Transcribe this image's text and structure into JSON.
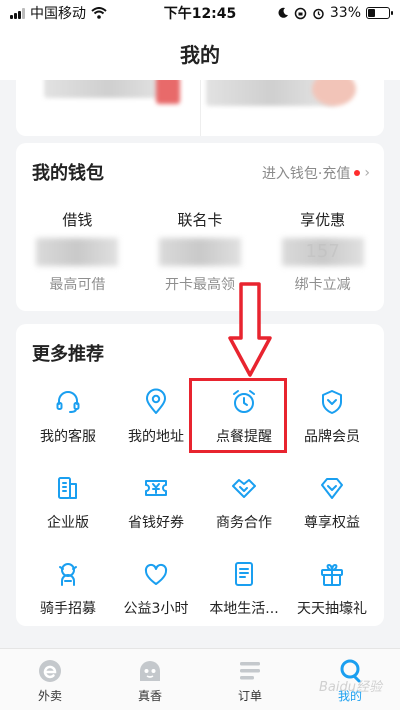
{
  "status_bar": {
    "carrier": "中国移动",
    "time": "下午12:45",
    "battery": "33%"
  },
  "header": {
    "title": "我的"
  },
  "wallet": {
    "title": "我的钱包",
    "link": "进入钱包·充值",
    "items": [
      {
        "label": "借钱",
        "value": "",
        "sub": "最高可借"
      },
      {
        "label": "联名卡",
        "value": "",
        "sub": "开卡最高领"
      },
      {
        "label": "享优惠",
        "value": "157",
        "sub": "绑卡立减"
      }
    ]
  },
  "more": {
    "title": "更多推荐",
    "items": [
      {
        "label": "我的客服",
        "icon": "headset-icon"
      },
      {
        "label": "我的地址",
        "icon": "location-pin-icon"
      },
      {
        "label": "点餐提醒",
        "icon": "alarm-clock-icon"
      },
      {
        "label": "品牌会员",
        "icon": "badge-check-icon"
      },
      {
        "label": "企业版",
        "icon": "building-icon"
      },
      {
        "label": "省钱好券",
        "icon": "yuan-coupon-icon"
      },
      {
        "label": "商务合作",
        "icon": "handshake-icon"
      },
      {
        "label": "尊享权益",
        "icon": "diamond-icon"
      },
      {
        "label": "骑手招募",
        "icon": "rider-icon"
      },
      {
        "label": "公益3小时",
        "icon": "heart-hands-icon"
      },
      {
        "label": "本地生活...",
        "icon": "document-icon"
      },
      {
        "label": "天天抽壕礼",
        "icon": "gift-icon"
      }
    ]
  },
  "tabs": [
    {
      "label": "外卖",
      "icon": "eleme-logo-icon"
    },
    {
      "label": "真香",
      "icon": "mascot-icon"
    },
    {
      "label": "订单",
      "icon": "list-icon"
    },
    {
      "label": "我的",
      "icon": "profile-icon"
    }
  ],
  "watermark": "Baidu经验",
  "colors": {
    "accent": "#1a9ff0",
    "highlight": "#e8242f",
    "notice_dot": "#ff2d2d"
  }
}
